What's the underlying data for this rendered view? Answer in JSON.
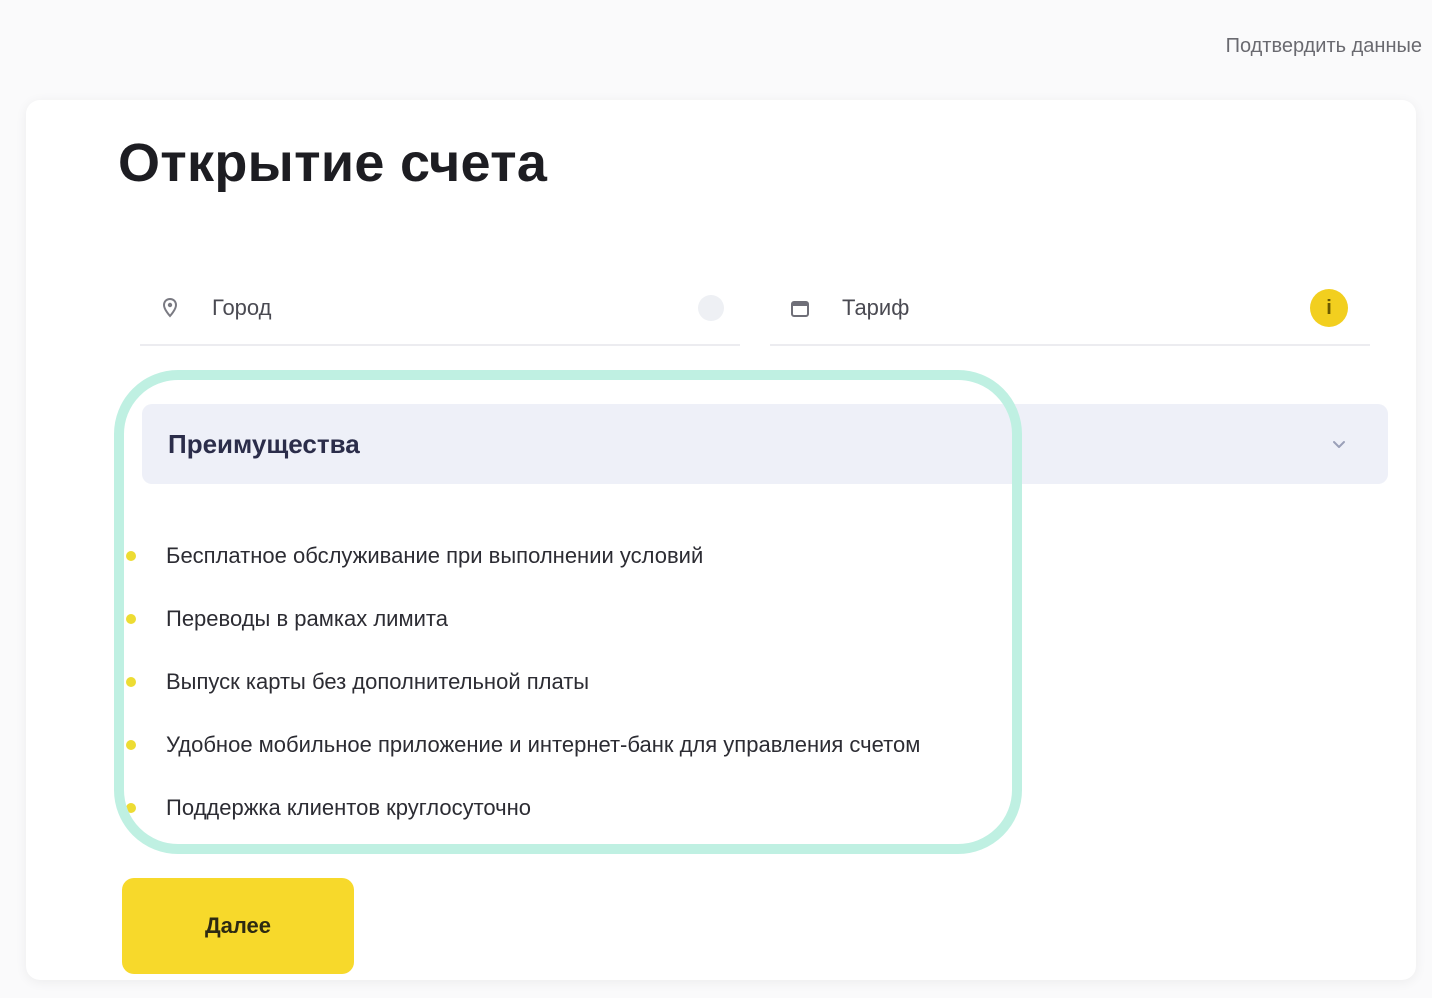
{
  "top_link": "Подтвердить данные",
  "page": {
    "title": "Открытие счета"
  },
  "form": {
    "left_field": {
      "value": "Город"
    },
    "right_field": {
      "value": "Тариф"
    }
  },
  "section": {
    "title": "Преимущества"
  },
  "features": [
    "Бесплатное обслуживание при выполнении условий",
    "Переводы в рамках лимита",
    "Выпуск карты без дополнительной платы",
    "Удобное мобильное приложение и интернет-банк для управления счетом",
    "Поддержка клиентов круглосуточно"
  ],
  "submit": {
    "label": "Далее"
  },
  "colors": {
    "accent_yellow": "#f7d92b",
    "highlight_ring": "#bff0e2",
    "section_bg": "#eef0f8"
  },
  "icons": {
    "left_field": "location-icon",
    "right_field": "calendar-icon",
    "info": "info-icon",
    "chevron": "chevron-down-icon"
  }
}
